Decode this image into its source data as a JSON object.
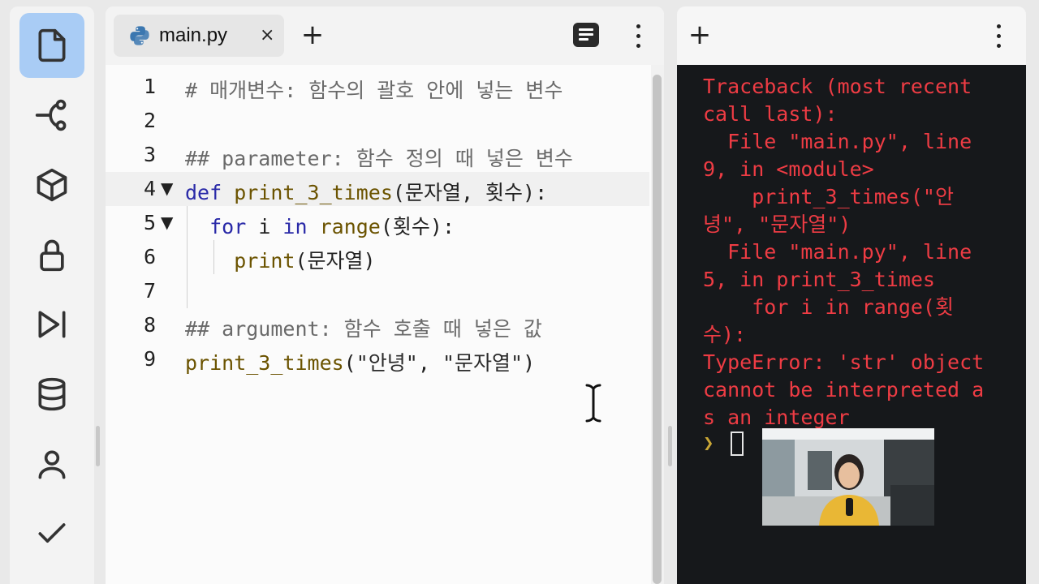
{
  "sidebar": {
    "items": [
      {
        "icon": "file-icon",
        "active": true
      },
      {
        "icon": "git-branch-icon",
        "active": false
      },
      {
        "icon": "package-icon",
        "active": false
      },
      {
        "icon": "lock-icon",
        "active": false
      },
      {
        "icon": "run-icon",
        "active": false
      },
      {
        "icon": "database-icon",
        "active": false
      },
      {
        "icon": "user-icon",
        "active": false
      },
      {
        "icon": "check-icon",
        "active": false
      }
    ]
  },
  "editor": {
    "tab": {
      "filename": "main.py",
      "close": "×",
      "icon": "python-icon"
    },
    "add_label": "+",
    "lines": [
      {
        "n": "1",
        "text": "# 매개변수: 함수의 괄호 안에 넣는 변수"
      },
      {
        "n": "2",
        "text": ""
      },
      {
        "n": "3",
        "text": "## parameter: 함수 정의 때 넣은 변수"
      },
      {
        "n": "4",
        "text": "def print_3_times(문자열, 횟수):"
      },
      {
        "n": "5",
        "text": "  for i in range(횟수):"
      },
      {
        "n": "6",
        "text": "    print(문자열)"
      },
      {
        "n": "7",
        "text": ""
      },
      {
        "n": "8",
        "text": "## argument: 함수 호출 때 넣은 값"
      },
      {
        "n": "9",
        "text": "print_3_times(\"안녕\", \"문자열\")"
      }
    ],
    "fold_markers": {
      "4": "▼",
      "5": "▼"
    },
    "active_line": "4"
  },
  "console": {
    "add_label": "+",
    "output": "Traceback (most recent call last):\n  File \"main.py\", line 9, in <module>\n    print_3_times(\"안녕\", \"문자열\")\n  File \"main.py\", line 5, in print_3_times\n    for i in range(횟수):\nTypeError: 'str' object cannot be interpreted as an integer",
    "prompt": "❯",
    "error_color": "#ee3c44"
  }
}
